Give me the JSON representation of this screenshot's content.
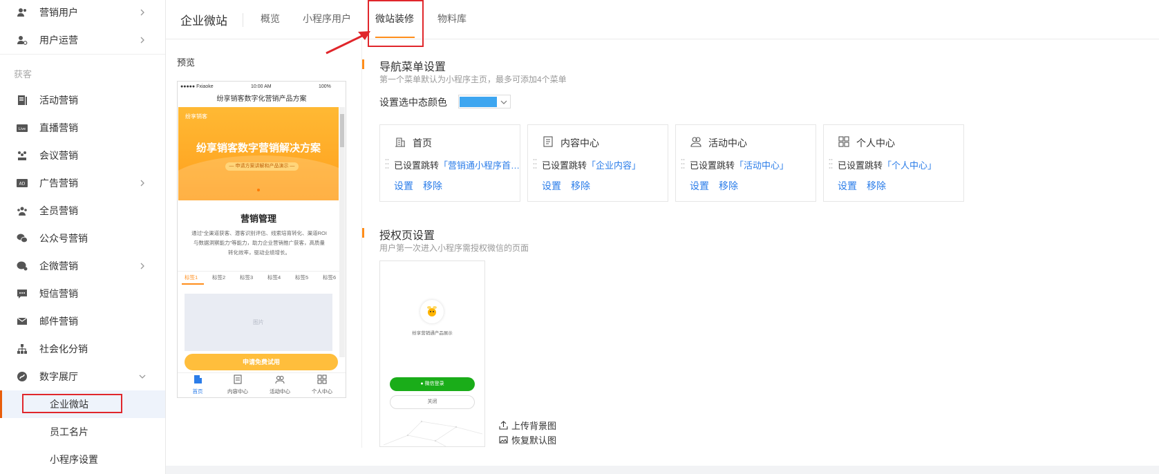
{
  "sidebar": {
    "top_items": [
      {
        "label": "营销用户",
        "icon": "users-icon",
        "arrow": true
      },
      {
        "label": "用户运营",
        "icon": "user-gear-icon",
        "arrow": true
      }
    ],
    "group_label": "获客",
    "items": [
      {
        "label": "活动营销",
        "icon": "activity-icon",
        "arrow": false
      },
      {
        "label": "直播营销",
        "icon": "live-icon",
        "arrow": false
      },
      {
        "label": "会议营销",
        "icon": "meeting-icon",
        "arrow": false
      },
      {
        "label": "广告营销",
        "icon": "ad-icon",
        "arrow": true
      },
      {
        "label": "全员营销",
        "icon": "team-icon",
        "arrow": false
      },
      {
        "label": "公众号营销",
        "icon": "wechat-icon",
        "arrow": false
      },
      {
        "label": "企微营销",
        "icon": "wecom-icon",
        "arrow": true
      },
      {
        "label": "短信营销",
        "icon": "sms-icon",
        "arrow": false
      },
      {
        "label": "邮件营销",
        "icon": "mail-icon",
        "arrow": false
      },
      {
        "label": "社会化分销",
        "icon": "distribution-icon",
        "arrow": false
      },
      {
        "label": "数字展厅",
        "icon": "showroom-icon",
        "arrow": true
      }
    ],
    "sub_items": [
      "企业微站",
      "员工名片",
      "小程序设置"
    ]
  },
  "header": {
    "title": "企业微站",
    "tabs": [
      "概览",
      "小程序用户",
      "微站装修",
      "物料库"
    ],
    "active_tab": "微站装修"
  },
  "preview": {
    "label": "预览",
    "status_carrier": "●●●●● Fxiaoke",
    "status_time": "10:00 AM",
    "status_battery": "100%",
    "page_title": "纷享销客数字化营销产品方案",
    "banner_logo": "纷享销客",
    "banner_title": "纷享销客数字营销解决方案",
    "banner_sub": "— 申请方案讲解和产品演示 —",
    "section_title": "营销管理",
    "section_text": "通过“全渠道获客、潜客识别评估、线索培育转化、渠道ROI与数据洞察能力”等能力，助力企业营销推广获客，高质量转化效率，驱动业绩增长。",
    "tabs": [
      "标签1",
      "标签2",
      "标签3",
      "标签4",
      "标签5",
      "标签6"
    ],
    "image_placeholder": "图片",
    "cta": "申请免费试用",
    "bottom_nav": [
      {
        "label": "首页",
        "icon": "home-icon"
      },
      {
        "label": "内容中心",
        "icon": "content-icon"
      },
      {
        "label": "活动中心",
        "icon": "activity-center-icon"
      },
      {
        "label": "个人中心",
        "icon": "personal-icon"
      }
    ]
  },
  "nav_section": {
    "title": "导航菜单设置",
    "desc": "第一个菜单默认为小程序主页，最多可添加4个菜单",
    "color_label": "设置选中态颜色",
    "color_value": "#3ea6f0",
    "jump_prefix": "已设置跳转",
    "set_label": "设置",
    "remove_label": "移除",
    "cards": [
      {
        "title": "首页",
        "icon": "building-icon",
        "target": "「营销通小程序首…"
      },
      {
        "title": "内容中心",
        "icon": "document-icon",
        "target": "「企业内容」"
      },
      {
        "title": "活动中心",
        "icon": "people-icon",
        "target": "「活动中心」"
      },
      {
        "title": "个人中心",
        "icon": "grid-icon",
        "target": "「个人中心」"
      }
    ]
  },
  "auth_section": {
    "title": "授权页设置",
    "desc": "用户第一次进入小程序需授权微信的页面",
    "app_name": "纷享营销通产品展示",
    "wechat_login": "微信登录",
    "close": "关闭",
    "upload_bg": "上传背景图",
    "restore_default": "恢复默认图"
  },
  "colors": {
    "accent": "#ff8d1a",
    "link": "#2b7de9",
    "highlight": "#e0262b"
  }
}
